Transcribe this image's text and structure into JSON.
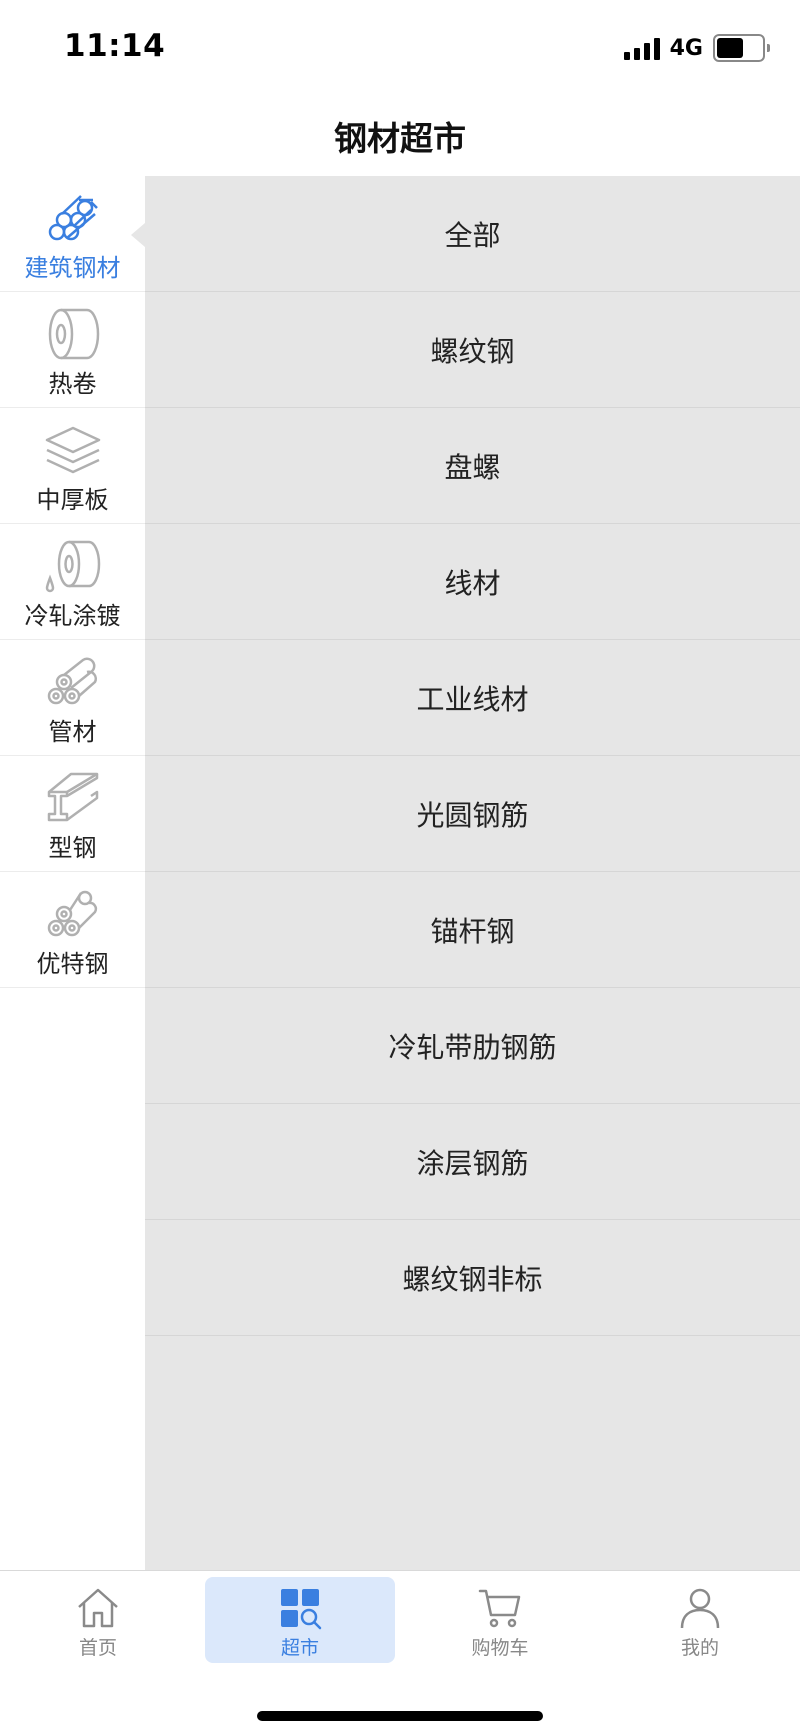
{
  "status_bar": {
    "time": "11:14",
    "network": "4G",
    "battery_level": 0.6
  },
  "header": {
    "title": "钢材超市"
  },
  "sidebar": {
    "active_index": 0,
    "items": [
      {
        "label": "建筑钢材",
        "icon": "rebar-bundle-icon"
      },
      {
        "label": "热卷",
        "icon": "coil-roll-icon"
      },
      {
        "label": "中厚板",
        "icon": "stacked-plates-icon"
      },
      {
        "label": "冷轧涂镀",
        "icon": "coated-coil-icon"
      },
      {
        "label": "管材",
        "icon": "pipes-icon"
      },
      {
        "label": "型钢",
        "icon": "i-beam-icon"
      },
      {
        "label": "优特钢",
        "icon": "special-steel-icon"
      }
    ]
  },
  "subcategories": [
    "全部",
    "螺纹钢",
    "盘螺",
    "线材",
    "工业线材",
    "光圆钢筋",
    "锚杆钢",
    "冷轧带肋钢筋",
    "涂层钢筋",
    "螺纹钢非标"
  ],
  "tabbar": {
    "active_index": 1,
    "tabs": [
      {
        "label": "首页",
        "icon": "home-icon"
      },
      {
        "label": "超市",
        "icon": "market-grid-icon"
      },
      {
        "label": "购物车",
        "icon": "cart-icon"
      },
      {
        "label": "我的",
        "icon": "user-icon"
      }
    ]
  },
  "colors": {
    "accent": "#3a7fe0",
    "content_bg": "#e6e6e6",
    "inactive_icon": "#b0b0b0"
  }
}
